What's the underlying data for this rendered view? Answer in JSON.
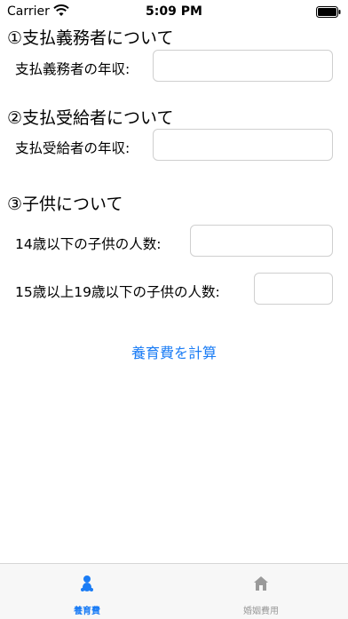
{
  "status_bar": {
    "carrier": "Carrier",
    "time": "5:09 PM"
  },
  "section1": {
    "title": "①支払義務者について",
    "income_label": "支払義務者の年収:"
  },
  "section2": {
    "title": "②支払受給者について",
    "income_label": "支払受給者の年収:"
  },
  "section3": {
    "title": "③子供について",
    "children_under14_label": "14歳以下の子供の人数:",
    "children_15to19_label": "15歳以上19歳以下の子供の人数:"
  },
  "calculate_button": "養育費を計算",
  "tab_bar": {
    "tabs": [
      {
        "label": "養育費",
        "icon": "baby-icon",
        "active": true
      },
      {
        "label": "婚姻費用",
        "icon": "house-icon",
        "active": false
      }
    ]
  },
  "colors": {
    "accent": "#1a7cf5",
    "inactive": "#9a9a9a"
  }
}
